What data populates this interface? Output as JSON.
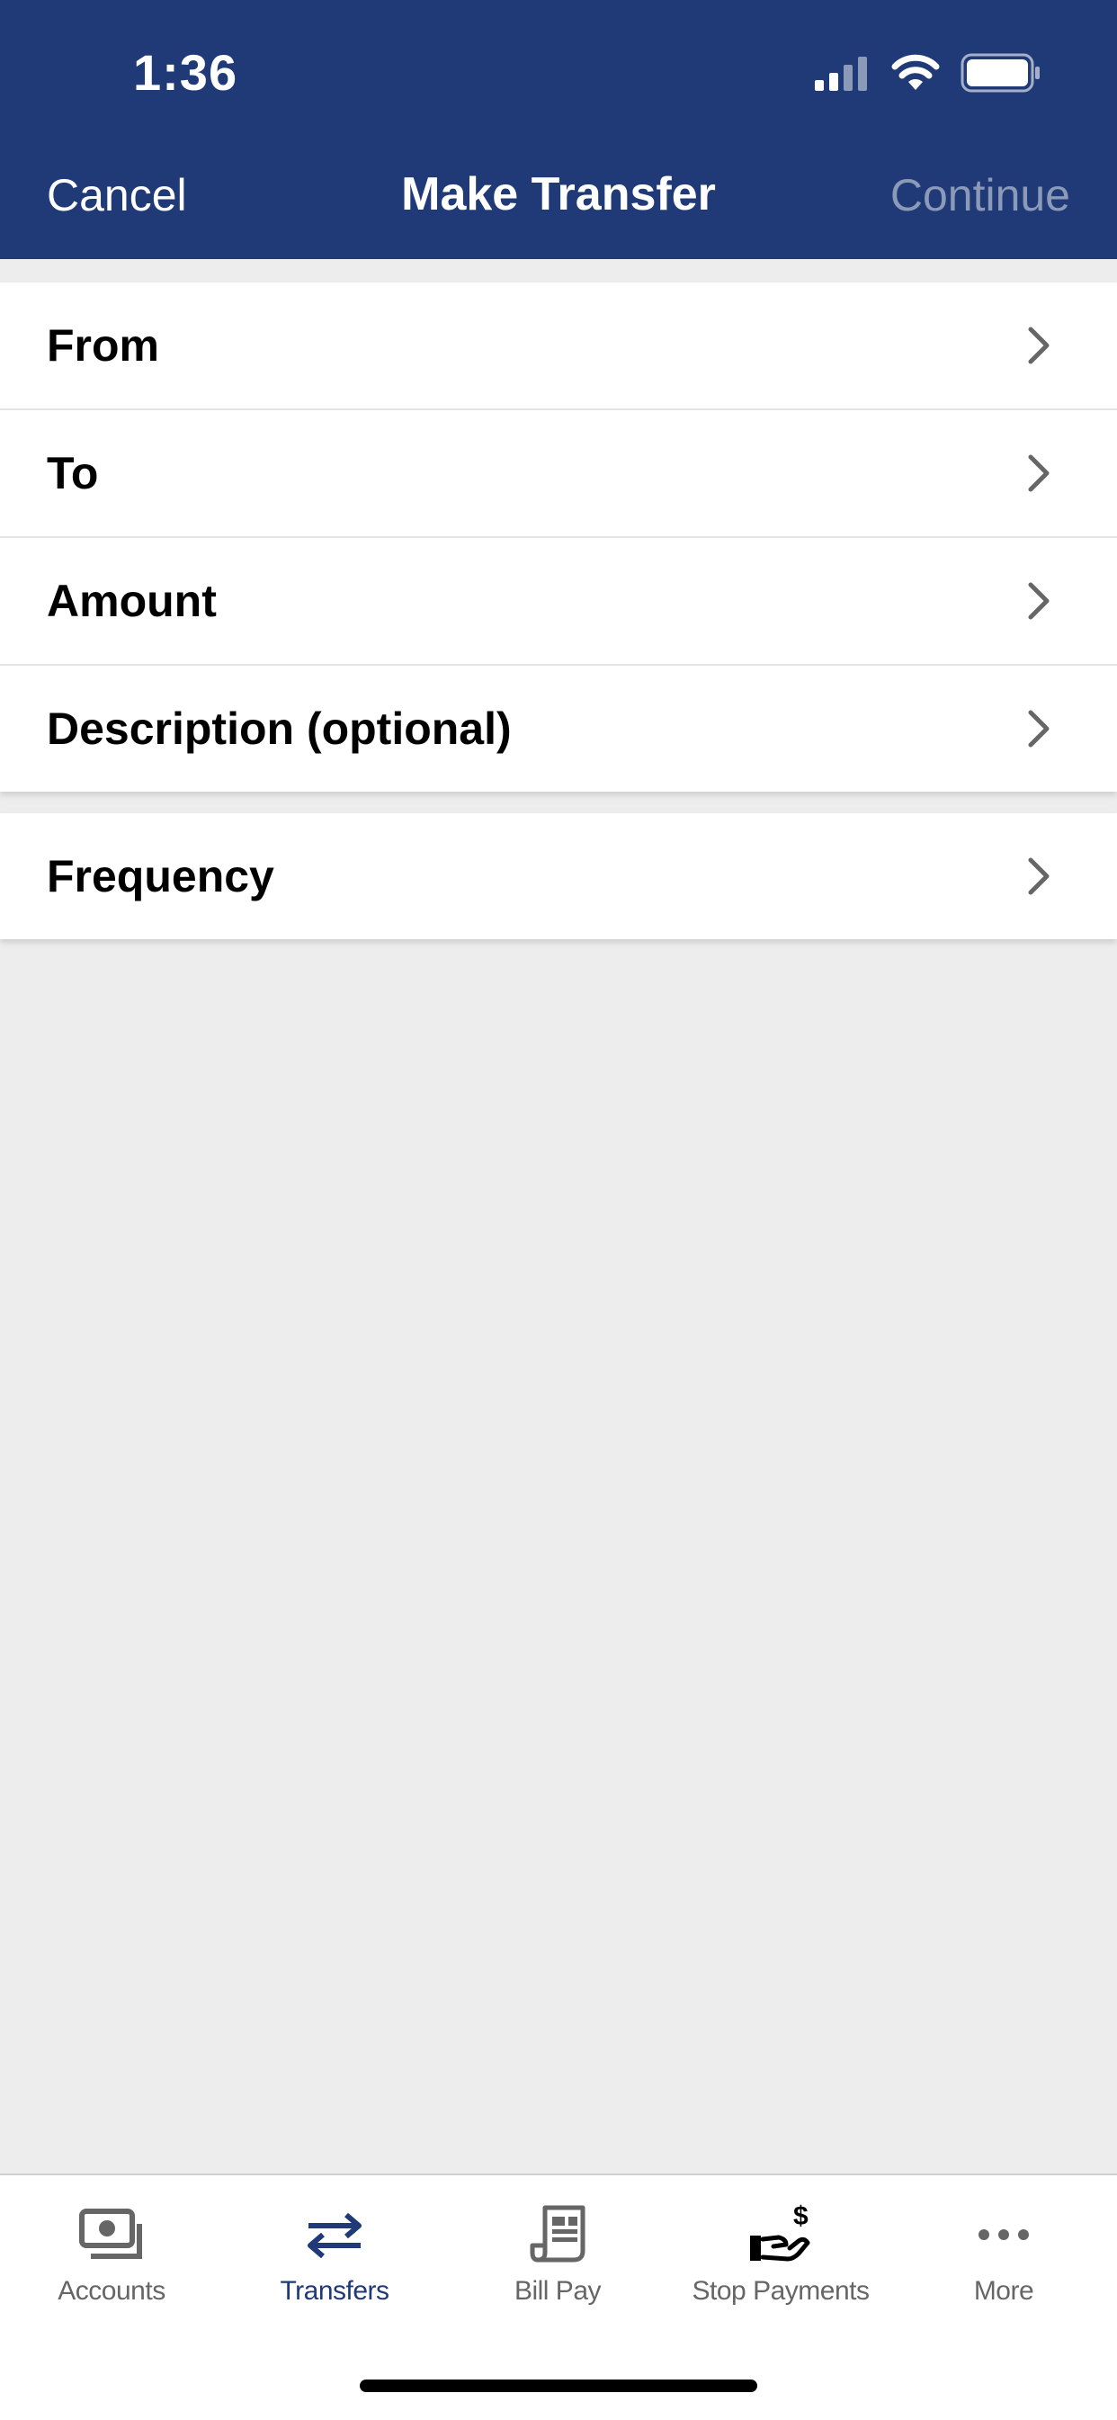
{
  "status_bar": {
    "time": "1:36"
  },
  "nav": {
    "cancel_label": "Cancel",
    "title": "Make Transfer",
    "continue_label": "Continue"
  },
  "form": {
    "group1": [
      {
        "label": "From"
      },
      {
        "label": "To"
      },
      {
        "label": "Amount"
      },
      {
        "label": "Description (optional)"
      }
    ],
    "group2": [
      {
        "label": "Frequency"
      }
    ]
  },
  "tabbar": {
    "tabs": [
      {
        "label": "Accounts",
        "icon": "cash-icon"
      },
      {
        "label": "Transfers",
        "icon": "transfer-arrows-icon",
        "active": true
      },
      {
        "label": "Bill Pay",
        "icon": "bill-icon"
      },
      {
        "label": "Stop Payments",
        "icon": "hand-dollar-icon"
      },
      {
        "label": "More",
        "icon": "more-dots-icon"
      }
    ]
  },
  "colors": {
    "header_bg": "#1f3a77",
    "page_bg": "#ededed",
    "continue_disabled": "#8b9ab8",
    "tab_active": "#1f3a77",
    "tab_inactive": "#666666"
  }
}
